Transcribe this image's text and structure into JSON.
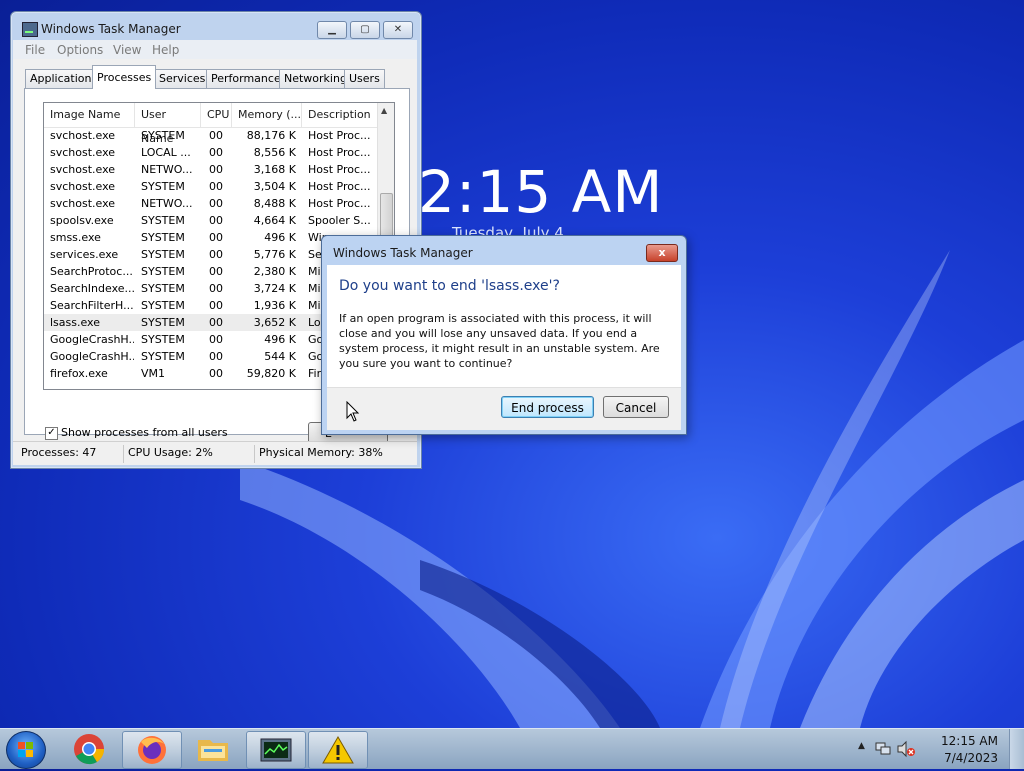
{
  "desktop": {
    "clock": "2:15 AM",
    "date": "Tuesday, July 4"
  },
  "task_manager": {
    "title": "Windows Task Manager",
    "menu": [
      "File",
      "Options",
      "View",
      "Help"
    ],
    "tabs": [
      "Applications",
      "Processes",
      "Services",
      "Performance",
      "Networking",
      "Users"
    ],
    "active_tab": "Processes",
    "columns": [
      "Image Name",
      "User Name",
      "CPU",
      "Memory (...",
      "Description"
    ],
    "rows": [
      {
        "image": "svchost.exe",
        "user": "SYSTEM",
        "cpu": "00",
        "mem": "88,176 K",
        "desc": "Host Proc..."
      },
      {
        "image": "svchost.exe",
        "user": "LOCAL ...",
        "cpu": "00",
        "mem": "8,556 K",
        "desc": "Host Proc..."
      },
      {
        "image": "svchost.exe",
        "user": "NETWO...",
        "cpu": "00",
        "mem": "3,168 K",
        "desc": "Host Proc..."
      },
      {
        "image": "svchost.exe",
        "user": "SYSTEM",
        "cpu": "00",
        "mem": "3,504 K",
        "desc": "Host Proc..."
      },
      {
        "image": "svchost.exe",
        "user": "NETWO...",
        "cpu": "00",
        "mem": "8,488 K",
        "desc": "Host Proc..."
      },
      {
        "image": "spoolsv.exe",
        "user": "SYSTEM",
        "cpu": "00",
        "mem": "4,664 K",
        "desc": "Spooler S..."
      },
      {
        "image": "smss.exe",
        "user": "SYSTEM",
        "cpu": "00",
        "mem": "496 K",
        "desc": "Win"
      },
      {
        "image": "services.exe",
        "user": "SYSTEM",
        "cpu": "00",
        "mem": "5,776 K",
        "desc": "Ser"
      },
      {
        "image": "SearchProtoc...",
        "user": "SYSTEM",
        "cpu": "00",
        "mem": "2,380 K",
        "desc": "Mic"
      },
      {
        "image": "SearchIndexe...",
        "user": "SYSTEM",
        "cpu": "00",
        "mem": "3,724 K",
        "desc": "Mic"
      },
      {
        "image": "SearchFilterH...",
        "user": "SYSTEM",
        "cpu": "00",
        "mem": "1,936 K",
        "desc": "Mic"
      },
      {
        "image": "lsass.exe",
        "user": "SYSTEM",
        "cpu": "00",
        "mem": "3,652 K",
        "desc": "Loc"
      },
      {
        "image": "GoogleCrashH...",
        "user": "SYSTEM",
        "cpu": "00",
        "mem": "496 K",
        "desc": "Goo"
      },
      {
        "image": "GoogleCrashH...",
        "user": "SYSTEM",
        "cpu": "00",
        "mem": "544 K",
        "desc": "Goo"
      },
      {
        "image": "firefox.exe",
        "user": "VM1",
        "cpu": "00",
        "mem": "59,820 K",
        "desc": "Fire"
      }
    ],
    "selected_row": "lsass.exe",
    "show_all_label": "Show processes from all users",
    "show_all_checked": true,
    "end_process_button_partial": "E",
    "status": {
      "processes": "Processes: 47",
      "cpu": "CPU Usage: 2%",
      "memory": "Physical Memory: 38%"
    }
  },
  "dialog": {
    "title": "Windows Task Manager",
    "heading": "Do you want to end 'lsass.exe'?",
    "message": "If an open program is associated with this process, it will close and you will lose any unsaved data. If you end a system process, it might result in an unstable system. Are you sure you want to continue?",
    "end_button": "End process",
    "cancel_button": "Cancel",
    "close_glyph": "x"
  },
  "taskbar": {
    "items": [
      "start-orb-icon",
      "chrome-icon",
      "firefox-icon",
      "explorer-folder-icon",
      "task-manager-icon",
      "warning-icon"
    ],
    "tray_time": "12:15 AM",
    "tray_date": "7/4/2023"
  },
  "colors": {
    "dialog_heading": "#1e3f8a",
    "desktop_bg": "#1d3fd8"
  }
}
